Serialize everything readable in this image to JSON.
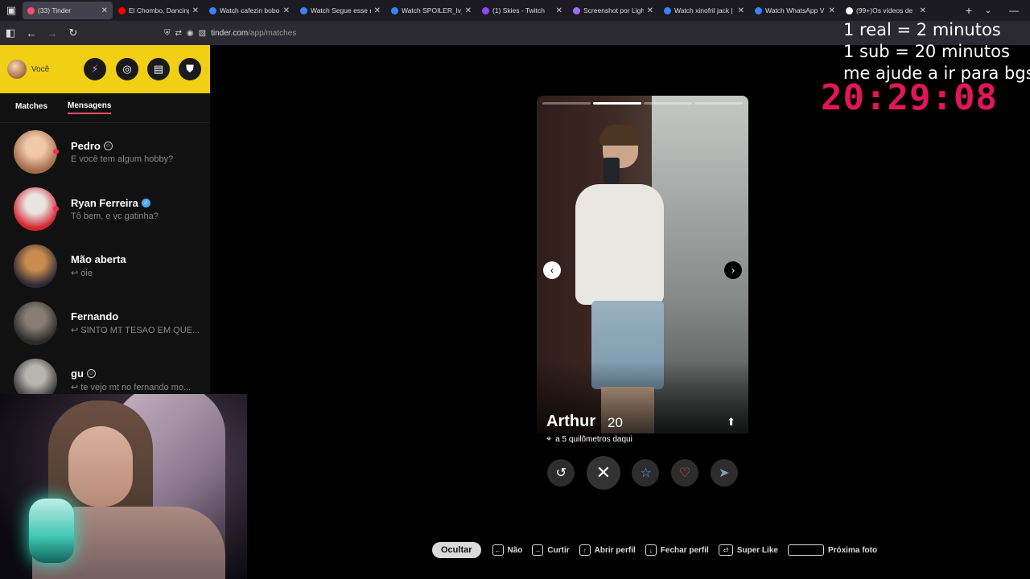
{
  "browser": {
    "tabs": [
      {
        "title": "(33) Tinder",
        "fav": "#fd4e6b",
        "active": true
      },
      {
        "title": "El Chombo, Dancing",
        "fav": "#ff0000",
        "active": false
      },
      {
        "title": "Watch cafezin bobo",
        "fav": "#3b82f6",
        "active": false
      },
      {
        "title": "Watch Segue esse n",
        "fav": "#3b82f6",
        "active": false
      },
      {
        "title": "Watch SPOILER_lv_G",
        "fav": "#3b82f6",
        "active": false
      },
      {
        "title": "(1) Skies - Twitch",
        "fav": "#9146ff",
        "active": false
      },
      {
        "title": "Screenshot por Ligh",
        "fav": "#a36bff",
        "active": false
      },
      {
        "title": "Watch xinofril jack |",
        "fav": "#3b82f6",
        "active": false
      },
      {
        "title": "Watch WhatsApp V",
        "fav": "#3b82f6",
        "active": false
      },
      {
        "title": "(99+)Os vídeos de",
        "fav": "#ffffff",
        "active": false
      }
    ],
    "url_host": "tinder.com",
    "url_path": "/app/matches"
  },
  "sidebar": {
    "me_label": "Você",
    "tabs": [
      "Matches",
      "Mensagens"
    ],
    "active_tab": "Mensagens",
    "messages": [
      {
        "name": "Pedro",
        "preview": "E você tem algum hobby?",
        "badge": "smile",
        "unread": true,
        "avatar": [
          "#f0c9a8",
          "#a36b4a"
        ]
      },
      {
        "name": "Ryan Ferreira",
        "preview": "Tô bem, e vc gatinha?",
        "badge": "verified",
        "unread": true,
        "avatar": [
          "#e9e4e0",
          "#d22630"
        ]
      },
      {
        "name": "Mão aberta",
        "preview": "↩ oie",
        "badge": "",
        "unread": false,
        "avatar": [
          "#c98c4e",
          "#2c2a36"
        ]
      },
      {
        "name": "Fernando",
        "preview": "↩ SINTO MT TESAO EM QUE...",
        "badge": "",
        "unread": false,
        "avatar": [
          "#8a7e74",
          "#2b2b2b"
        ]
      },
      {
        "name": "gu",
        "preview": "↩ te vejo mt no fernando mo...",
        "badge": "smile",
        "unread": false,
        "avatar": [
          "#b8b4b0",
          "#3a3a3a"
        ]
      }
    ]
  },
  "card": {
    "name": "Arthur",
    "age": "20",
    "location": "a 5 quilômetros daqui",
    "photo_count": 4,
    "active_photo": 1
  },
  "hints": {
    "hide": "Ocultar",
    "items": [
      {
        "key": "←",
        "label": "Não"
      },
      {
        "key": "→",
        "label": "Curtir"
      },
      {
        "key": "↑",
        "label": "Abrir perfil"
      },
      {
        "key": "↓",
        "label": "Fechar perfil"
      },
      {
        "key": "⏎",
        "label": "Super Like"
      },
      {
        "key": "",
        "label": "Próxima foto"
      }
    ]
  },
  "overlay": {
    "line1": "1 real = 2 minutos",
    "line2": "1 sub = 20 minutos",
    "line3": "me ajude a ir para bgs",
    "timer": "20:29:08"
  },
  "colors": {
    "tinder_yellow": "#f1cf14",
    "tinder_pink": "#fd4e6b",
    "timer": "#e0165a"
  }
}
